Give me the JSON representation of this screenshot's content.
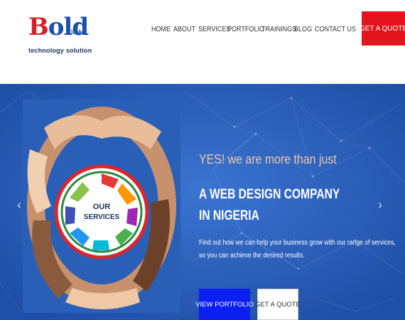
{
  "brand": {
    "logo_text_b": "B",
    "logo_text_old": "old",
    "logo_links": "links",
    "tagline": "technology solution"
  },
  "nav": {
    "items": [
      "HOME",
      "ABOUT",
      "SERVICES",
      "PORTFOLIO",
      "TRAININGS",
      "BLOG",
      "CONTACT US"
    ],
    "cta": "GET A QUOTE"
  },
  "hero": {
    "image_label": "OUR SERVICES",
    "yes_line": "YES! we are more than just",
    "heading_line1": "A WEB DESIGN COMPANY",
    "heading_line2": "IN NIGERIA",
    "description_line1": "Find out how we can help your business grow with our range of services,",
    "description_line2": "so you can achieve the desired results.",
    "btn_portfolio": "VIEW PORTFOLIO",
    "btn_quote": "GET A QUOTE",
    "prev_icon": "chevron-left-icon",
    "next_icon": "chevron-right-icon"
  },
  "colors": {
    "hero_bg": "#2f63bf",
    "accent_red": "#e3141b",
    "portfolio_blue": "#0a1ff0",
    "yes_text": "#f3c7a5"
  }
}
